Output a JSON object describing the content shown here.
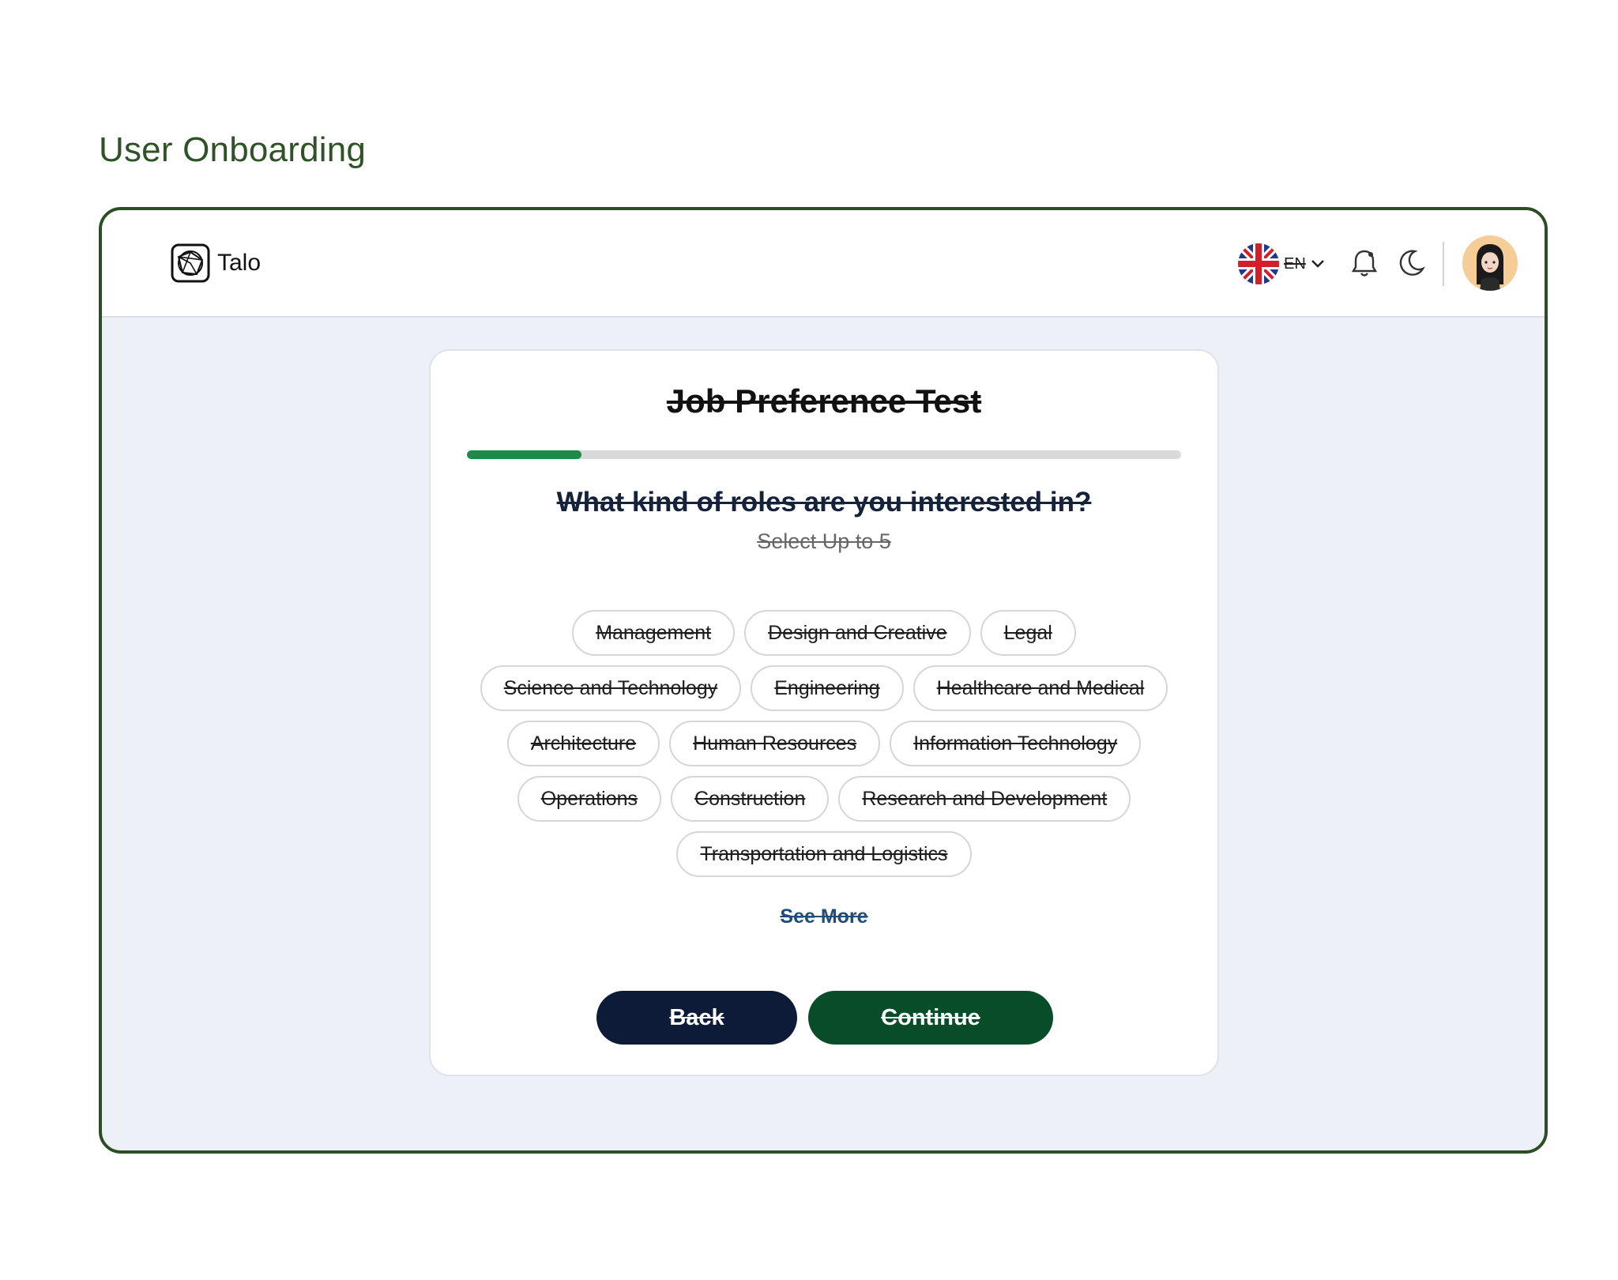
{
  "page": {
    "section_title": "User Onboarding"
  },
  "header": {
    "brand": "Talo",
    "language": {
      "code": "EN",
      "flag": "uk-flag-icon"
    },
    "icons": [
      "talo-logo-icon",
      "bell-icon",
      "moon-icon",
      "user-avatar"
    ]
  },
  "card": {
    "title": "Job Preference Test",
    "progress": 0.16,
    "question": "What kind of roles are you interested in?",
    "subtitle": "Select Up to 5",
    "options": [
      "Management",
      "Design and Creative",
      "Legal",
      "Science and Technology",
      "Engineering",
      "Healthcare and Medical",
      "Architecture",
      "Human Resources",
      "Information Technology",
      "Operations",
      "Construction",
      "Research and Development",
      "Transportation and Logistics"
    ],
    "see_more": "See More",
    "back_label": "Back",
    "continue_label": "Continue"
  },
  "colors": {
    "frame_border": "#2c4e25",
    "progress_fill": "#1e8a4a",
    "back_button": "#0d1b38",
    "continue_button": "#084d2a",
    "page_bg": "#edf0f6"
  }
}
